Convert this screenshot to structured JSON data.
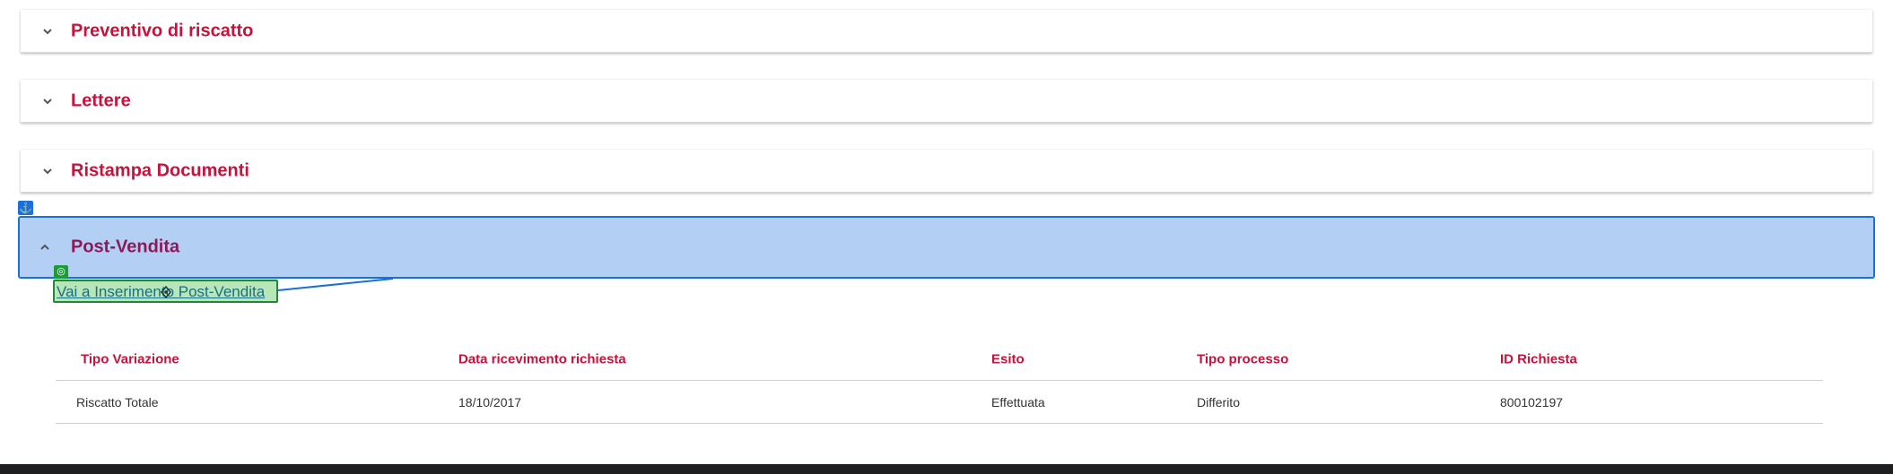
{
  "panels": [
    {
      "title": "Preventivo di riscatto",
      "expanded": false,
      "chevron_icon": "chevron-down-icon"
    },
    {
      "title": "Lettere",
      "expanded": false,
      "chevron_icon": "chevron-down-icon"
    },
    {
      "title": "Ristampa Documenti",
      "expanded": false,
      "chevron_icon": "chevron-down-icon"
    },
    {
      "title": "Post-Vendita",
      "expanded": true,
      "chevron_icon": "chevron-up-icon"
    }
  ],
  "post_vendita": {
    "link_label": "Vai a Inserimento Post-Vendita",
    "table": {
      "headers": [
        "Tipo Variazione",
        "Data ricevimento richiesta",
        "Esito",
        "Tipo processo",
        "ID Richiesta"
      ],
      "rows": [
        [
          "Riscatto Totale",
          "18/10/2017",
          "Effettuata",
          "Differito",
          "800102197"
        ]
      ]
    }
  },
  "overlay": {
    "anchor_icon": "anchor-icon",
    "target_icon": "target-icon",
    "move_icon": "move-icon"
  },
  "colors": {
    "accent": "#c4133c",
    "expanded_bg": "#b3d0f4",
    "expanded_border": "#1a6fd8",
    "link_box": "#b7e7b8"
  }
}
